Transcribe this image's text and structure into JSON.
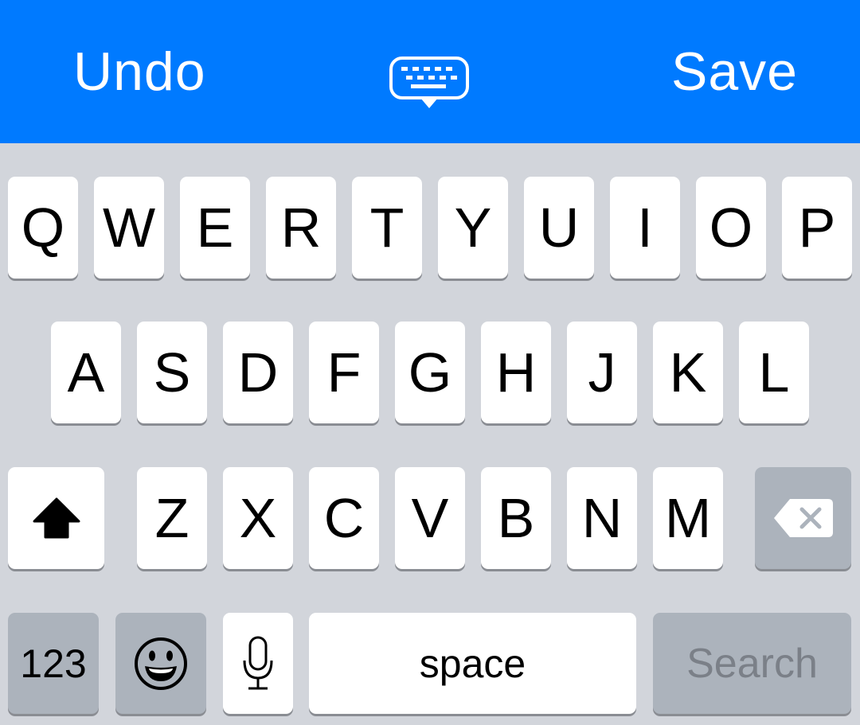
{
  "toolbar": {
    "undo_label": "Undo",
    "save_label": "Save",
    "center_icon": "keyboard-dismiss-icon",
    "background_color": "#007aff"
  },
  "keyboard": {
    "row1": [
      "Q",
      "W",
      "E",
      "R",
      "T",
      "Y",
      "U",
      "I",
      "O",
      "P"
    ],
    "row2": [
      "A",
      "S",
      "D",
      "F",
      "G",
      "H",
      "J",
      "K",
      "L"
    ],
    "row3": [
      "Z",
      "X",
      "C",
      "V",
      "B",
      "N",
      "M"
    ],
    "shift_icon": "shift-arrow-icon",
    "delete_icon": "backspace-icon",
    "numbers_label": "123",
    "emoji_icon": "emoji-smiley-icon",
    "mic_icon": "microphone-icon",
    "space_label": "space",
    "search_label": "Search",
    "background_color": "#d2d5db",
    "special_key_color": "#acb3bc"
  }
}
